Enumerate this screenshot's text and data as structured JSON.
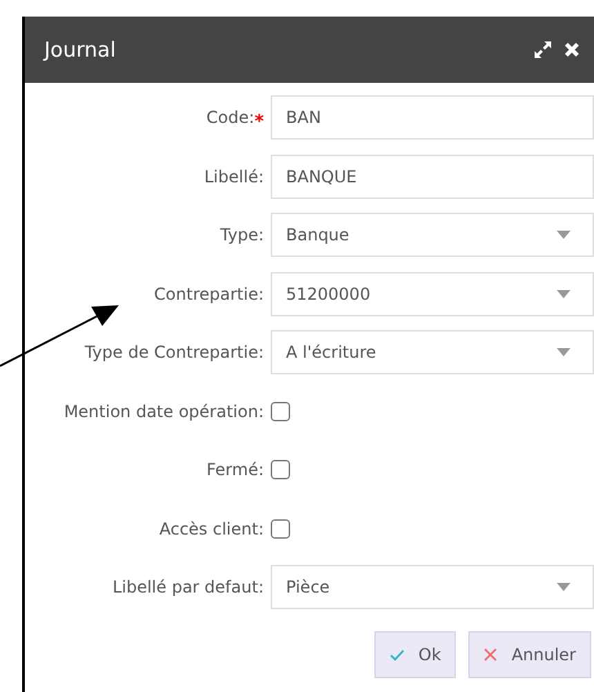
{
  "dialog": {
    "title": "Journal"
  },
  "fields": [
    {
      "kind": "text",
      "label": "Code:",
      "required_mark": "*",
      "value": "BAN"
    },
    {
      "kind": "text",
      "label": "Libellé:",
      "value": "BANQUE"
    },
    {
      "kind": "select",
      "label": "Type:",
      "value": "Banque"
    },
    {
      "kind": "select",
      "label": "Contrepartie:",
      "value": "51200000"
    },
    {
      "kind": "select",
      "label": "Type de Contrepartie:",
      "value": "A l'écriture"
    },
    {
      "kind": "checkbox",
      "label": "Mention date opération:",
      "checked": false
    },
    {
      "kind": "checkbox",
      "label": "Fermé:",
      "checked": false
    },
    {
      "kind": "checkbox",
      "label": "Accès client:",
      "checked": false
    },
    {
      "kind": "select",
      "label": "Libellé par defaut:",
      "value": "Pièce"
    }
  ],
  "buttons": [
    {
      "kind": "ok",
      "label": "Ok"
    },
    {
      "kind": "cancel",
      "label": "Annuler"
    }
  ]
}
